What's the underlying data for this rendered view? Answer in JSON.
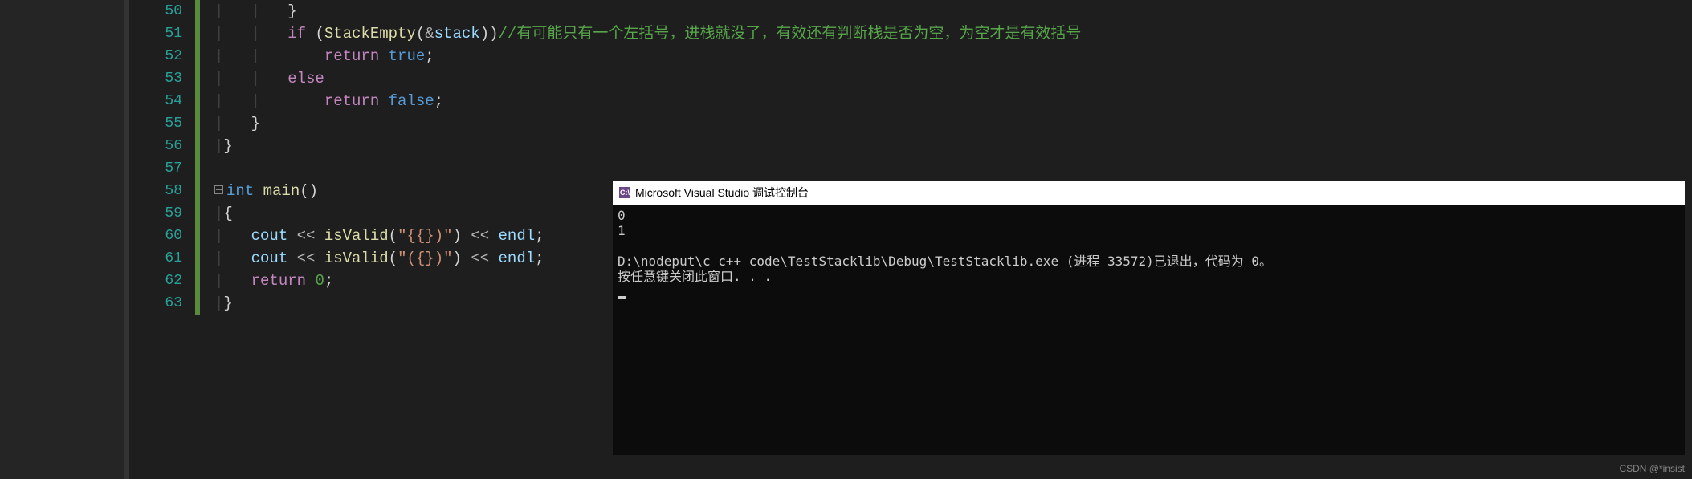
{
  "line_numbers": [
    "50",
    "51",
    "52",
    "53",
    "54",
    "55",
    "56",
    "57",
    "58",
    "59",
    "60",
    "61",
    "62",
    "63"
  ],
  "code": {
    "l50": {
      "brace": "}"
    },
    "l51": {
      "if": "if",
      "lparen": "(",
      "fn": "StackEmpty",
      "lp2": "(",
      "amp": "&",
      "var": "stack",
      "rp2": ")",
      "rparen": ")",
      "cmt": "//有可能只有一个左括号，进栈就没了，有效还有判断栈是否为空，为空才是有效括号"
    },
    "l52": {
      "ret": "return",
      "val": "true",
      "semi": ";"
    },
    "l53": {
      "else": "else"
    },
    "l54": {
      "ret": "return",
      "val": "false",
      "semi": ";"
    },
    "l55": {
      "brace": "}"
    },
    "l56": {
      "brace": "}"
    },
    "l58": {
      "type": "int",
      "fn": "main",
      "parens": "()"
    },
    "l59": {
      "brace": "{"
    },
    "l60": {
      "cout": "cout",
      "ls1": "<<",
      "fn": "isValid",
      "lp": "(",
      "q1": "\"",
      "s": "{{})",
      "q2": "\"",
      "rp": ")",
      "ls2": "<<",
      "endl": "endl",
      "semi": ";"
    },
    "l61": {
      "cout": "cout",
      "ls1": "<<",
      "fn": "isValid",
      "lp": "(",
      "q1": "\"",
      "s": "({})",
      "q2": "\"",
      "rp": ")",
      "ls2": "<<",
      "endl": "endl",
      "semi": ";"
    },
    "l62": {
      "ret": "return",
      "val": "0",
      "semi": ";"
    },
    "l63": {
      "brace": "}"
    }
  },
  "console": {
    "title": "Microsoft Visual Studio 调试控制台",
    "lines": {
      "o1": "0",
      "o2": "1",
      "o3": "",
      "o4": "D:\\nodeput\\c c++ code\\TestStacklib\\Debug\\TestStacklib.exe (进程 33572)已退出，代码为 0。",
      "o5": "按任意键关闭此窗口. . ."
    }
  },
  "watermark": "CSDN @*insist"
}
